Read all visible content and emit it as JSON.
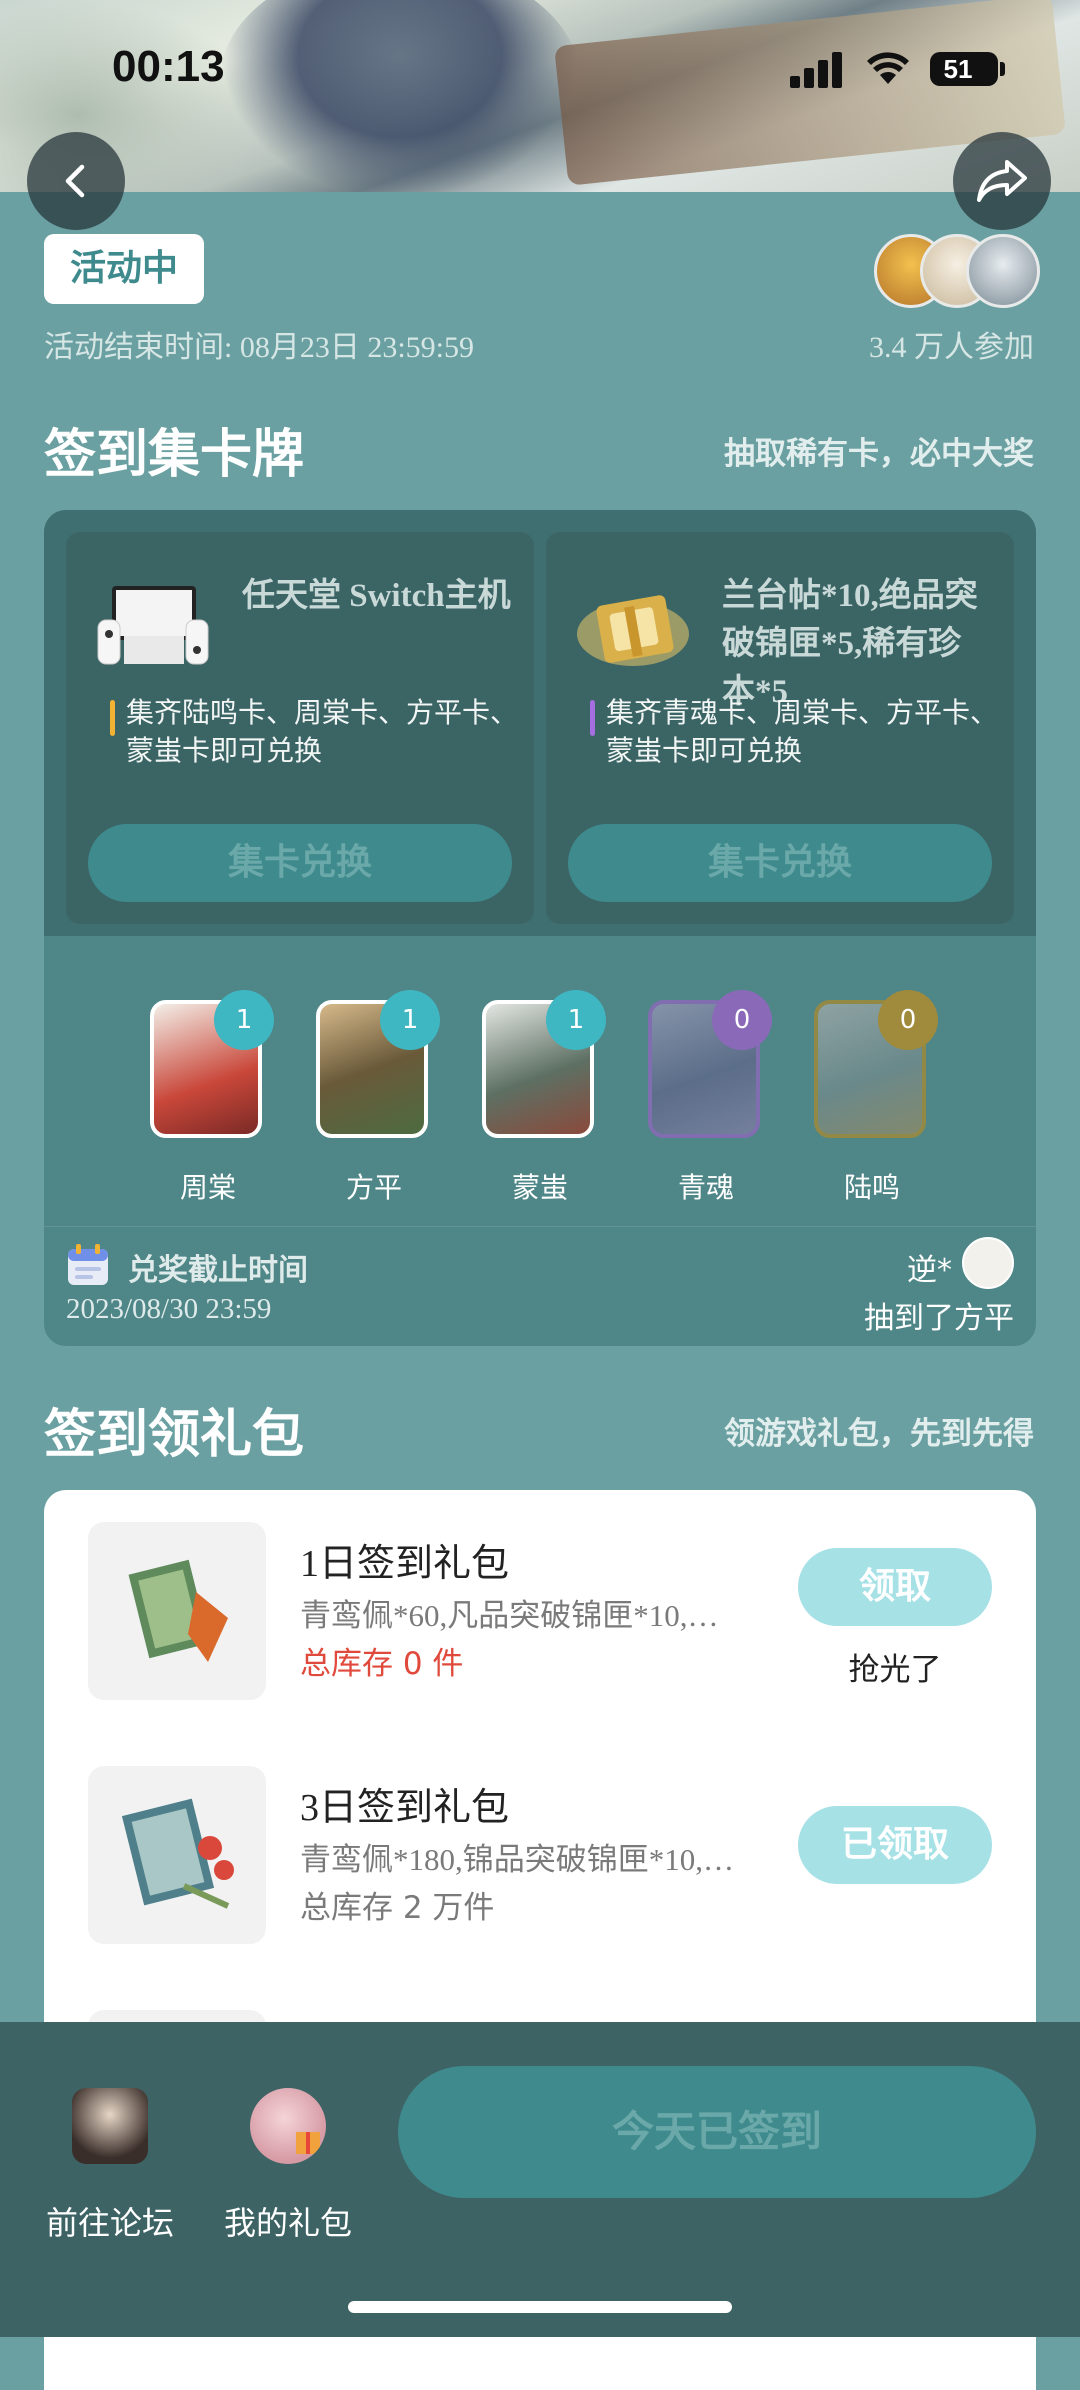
{
  "status": {
    "time": "00:13",
    "battery": "51"
  },
  "activity": {
    "state": "活动中",
    "end_time": "活动结束时间: 08月23日 23:59:59",
    "participants": "3.4 万人参加"
  },
  "card_section": {
    "title": "签到集卡牌",
    "subtitle": "抽取稀有卡，必中大奖"
  },
  "prizes": [
    {
      "name": "任天堂 Switch主机",
      "desc": "集齐陆鸣卡、周棠卡、方平卡、蒙蚩卡即可兑换",
      "button": "集卡兑换",
      "bar_color": "#f2b233"
    },
    {
      "name": "兰台帖*10,绝品突破锦匣*5,稀有珍本*5",
      "desc": "集齐青魂卡、周棠卡、方平卡、蒙蚩卡即可兑换",
      "button": "集卡兑换",
      "bar_color": "#a46ee0"
    }
  ],
  "cards": [
    {
      "name": "周棠",
      "count": "1",
      "badge_color": "#3fb7c2",
      "frame": "#ffffff"
    },
    {
      "name": "方平",
      "count": "1",
      "badge_color": "#3fb7c2",
      "frame": "#ffffff"
    },
    {
      "name": "蒙蚩",
      "count": "1",
      "badge_color": "#3fb7c2",
      "frame": "#ffffff"
    },
    {
      "name": "青魂",
      "count": "0",
      "badge_color": "#8a6ab8",
      "frame": "#8a6ab8"
    },
    {
      "name": "陆鸣",
      "count": "0",
      "badge_color": "#a08a3c",
      "frame": "#a08a3c"
    }
  ],
  "deadline": {
    "label": "兑奖截止时间",
    "date": "2023/08/30 23:59"
  },
  "winner": {
    "name": "逆*",
    "text": "抽到了方平"
  },
  "gift_section": {
    "title": "签到领礼包",
    "subtitle": "领游戏礼包，先到先得"
  },
  "gifts": [
    {
      "title": "1日签到礼包",
      "detail": "青鸾佩*60,凡品突破锦匣*10,…",
      "stock": "总库存 0 件",
      "button": "领取",
      "note": "抢光了"
    },
    {
      "title": "3日签到礼包",
      "detail": "青鸾佩*180,锦品突破锦匣*10,…",
      "stock": "总库存 2 万件",
      "button": "已领取",
      "note": ""
    }
  ],
  "bottom": {
    "forum": "前往论坛",
    "my_gifts": "我的礼包",
    "signin": "今天已签到"
  }
}
